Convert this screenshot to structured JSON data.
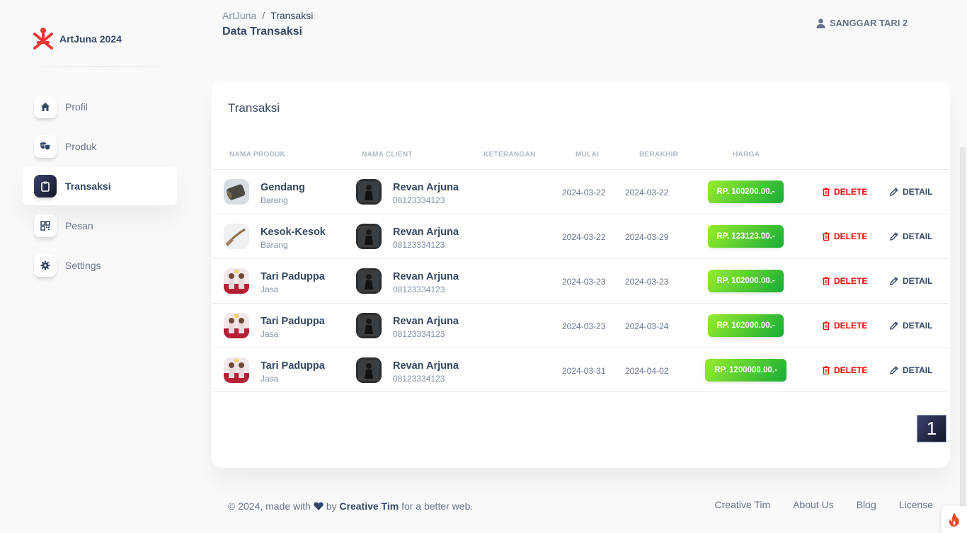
{
  "brand": {
    "name": "ArtJuna 2024"
  },
  "sidebar": {
    "items": [
      {
        "label": "Profil",
        "icon": "home-icon"
      },
      {
        "label": "Produk",
        "icon": "theater-masks-icon"
      },
      {
        "label": "Transaksi",
        "icon": "clipboard-icon",
        "active": true
      },
      {
        "label": "Pesan",
        "icon": "qrcode-icon"
      },
      {
        "label": "Settings",
        "icon": "gear-icon"
      }
    ]
  },
  "header": {
    "breadcrumb_root": "ArtJuna",
    "breadcrumb_sep": "/",
    "breadcrumb_current": "Transaksi",
    "page_title": "Data Transaksi",
    "user_name": "SANGGAR TARI 2"
  },
  "card": {
    "title": "Transaksi",
    "columns": [
      "Nama Produk",
      "Nama Client",
      "Keterangan",
      "Mulai",
      "Berakhir",
      "Harga"
    ],
    "rows": [
      {
        "product": "Gendang",
        "category": "Barang",
        "client": "Revan Arjuna",
        "phone": "08123334123",
        "keterangan": "",
        "start": "2024-03-22",
        "end": "2024-03-22",
        "price": "RP. 100200.00.-",
        "delete": "DELETE",
        "detail": "DETAIL"
      },
      {
        "product": "Kesok-Kesok",
        "category": "Barang",
        "client": "Revan Arjuna",
        "phone": "08123334123",
        "keterangan": "",
        "start": "2024-03-22",
        "end": "2024-03-29",
        "price": "RP. 123123.00.-",
        "delete": "DELETE",
        "detail": "DETAIL"
      },
      {
        "product": "Tari Paduppa",
        "category": "Jasa",
        "client": "Revan Arjuna",
        "phone": "08123334123",
        "keterangan": "",
        "start": "2024-03-23",
        "end": "2024-03-23",
        "price": "RP. 102000.00.-",
        "delete": "DELETE",
        "detail": "DETAIL"
      },
      {
        "product": "Tari Paduppa",
        "category": "Jasa",
        "client": "Revan Arjuna",
        "phone": "08123334123",
        "keterangan": "",
        "start": "2024-03-23",
        "end": "2024-03-24",
        "price": "RP. 102000.00.-",
        "delete": "DELETE",
        "detail": "DETAIL"
      },
      {
        "product": "Tari Paduppa",
        "category": "Jasa",
        "client": "Revan Arjuna",
        "phone": "08123334123",
        "keterangan": "",
        "start": "2024-03-31",
        "end": "2024-04-02",
        "price": "RP. 1200000.00.-",
        "delete": "DELETE",
        "detail": "DETAIL"
      }
    ],
    "pagination": {
      "current": "1"
    }
  },
  "footer": {
    "copyright_prefix": "© 2024, made with",
    "by": "by",
    "author": "Creative Tim",
    "suffix": "for a better web.",
    "links": [
      "Creative Tim",
      "About Us",
      "Blog",
      "License"
    ]
  },
  "colors": {
    "accent_dark": "#344767",
    "danger": "#ea0606",
    "success_from": "#17ad37",
    "success_to": "#98ec2d"
  }
}
